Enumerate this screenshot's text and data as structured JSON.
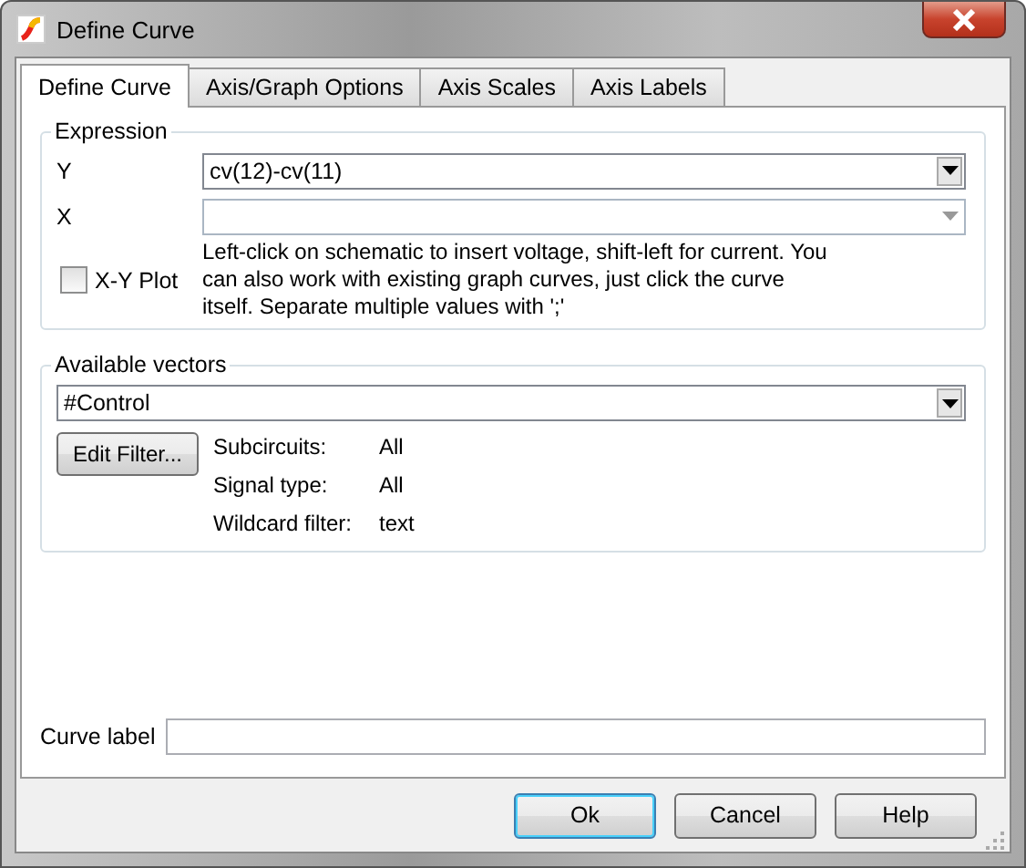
{
  "window": {
    "title": "Define Curve"
  },
  "tabs": [
    {
      "label": "Define Curve",
      "selected": true
    },
    {
      "label": "Axis/Graph Options",
      "selected": false
    },
    {
      "label": "Axis Scales",
      "selected": false
    },
    {
      "label": "Axis Labels",
      "selected": false
    }
  ],
  "expression": {
    "title": "Expression",
    "y_label": "Y",
    "y_value": "cv(12)-cv(11)",
    "x_label": "X",
    "x_disabled": true,
    "xy_plot": {
      "label": "X-Y Plot",
      "checked": false
    },
    "hint": "Left-click on schematic to insert voltage, shift-left for current. You can also work with existing graph curves, just click the curve itself. Separate multiple values with ';'"
  },
  "available_vectors": {
    "title": "Available vectors",
    "value": "#Control",
    "edit_filter": "Edit Filter...",
    "filters": [
      {
        "label": "Subcircuits:",
        "value": "All"
      },
      {
        "label": "Signal type:",
        "value": "All"
      },
      {
        "label": "Wildcard filter:",
        "value": "text"
      }
    ]
  },
  "curve_label": {
    "label": "Curve label"
  },
  "buttons": [
    {
      "label": "Ok",
      "default": true
    },
    {
      "label": "Cancel",
      "default": false
    },
    {
      "label": "Help",
      "default": false
    }
  ]
}
